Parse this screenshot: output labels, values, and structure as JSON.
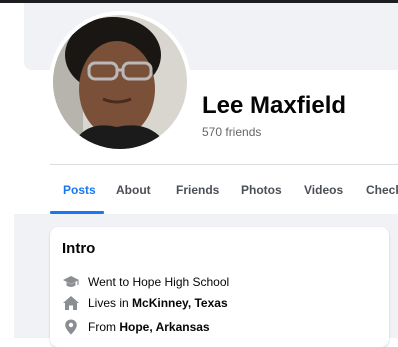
{
  "profile": {
    "name": "Lee Maxfield",
    "friends": "570 friends"
  },
  "tabs": [
    {
      "label": "Posts",
      "active": true
    },
    {
      "label": "About"
    },
    {
      "label": "Friends"
    },
    {
      "label": "Photos"
    },
    {
      "label": "Videos"
    },
    {
      "label": "Check"
    }
  ],
  "intro": {
    "title": "Intro",
    "items": [
      {
        "icon": "graduation-cap-icon",
        "text": "Went to Hope High School"
      },
      {
        "icon": "home-icon",
        "prefix": "Lives in ",
        "place": "McKinney, Texas"
      },
      {
        "icon": "location-pin-icon",
        "prefix": "From ",
        "place": "Hope, Arkansas"
      }
    ]
  },
  "colors": {
    "accent": "#1877f2",
    "page_background": "#f0f2f5",
    "secondary_text": "#65676b",
    "icon_gray": "#8a8d91"
  }
}
